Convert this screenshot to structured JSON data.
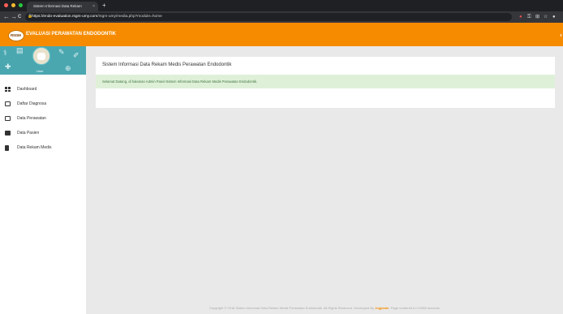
{
  "browser": {
    "tab_title": "Sistem Informasi Data Rekam",
    "tab_close": "×",
    "new_tab": "+",
    "nav_back": "←",
    "nav_forward": "→",
    "nav_reload": "C",
    "url_host": "https://endo-evaluation.rsgm-umy.com",
    "url_path": "/rsgm-umy/media.php?module=home",
    "colors": {
      "close": "#ff5f57",
      "minimize": "#febc2e",
      "maximize": "#28c840"
    }
  },
  "header": {
    "logo_text": "RSGM",
    "title": "EVALUASI PERAWATAN ENDODONTIK",
    "accent": "#f68b00"
  },
  "sidebar": {
    "user_label": "User",
    "items": [
      {
        "label": "Dashboard",
        "icon": "dashboard-icon"
      },
      {
        "label": "Daftar Diagnosa",
        "icon": "folder-icon"
      },
      {
        "label": "Data Perawatan",
        "icon": "folder-icon"
      },
      {
        "label": "Data Pasien",
        "icon": "folder-filled-icon"
      },
      {
        "label": "Data Rekam Medis",
        "icon": "file-icon"
      }
    ]
  },
  "main": {
    "card_title": "Sistem Informasi Data Rekam Medis Perawatan Endodontik",
    "alert_text": "Selamat Datang, di halaman Admin Panel Sistem Informasi Data Rekam Medis Perawatan Endodontik."
  },
  "footer": {
    "text_before": "Copyright © 2018 Sistem Informasi Data Rekam Medis Perawatan Endodontik. All Rights Reserved. Developed By ",
    "brand": "Jogjasite",
    "text_after": ". Page rendered in 0.0058 seconds"
  }
}
